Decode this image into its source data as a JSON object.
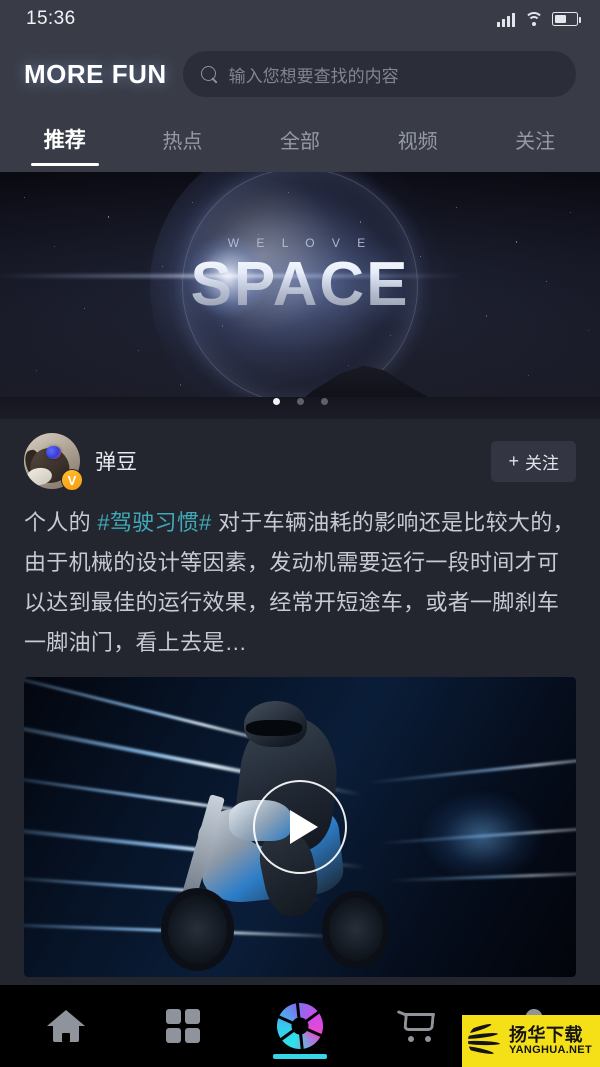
{
  "status_bar": {
    "time": "15:36",
    "icons": [
      "signal-icon",
      "wifi-icon",
      "battery-icon"
    ]
  },
  "header": {
    "brand": "MORE FUN",
    "search": {
      "placeholder": "输入您想要查找的内容",
      "value": "",
      "icon": "search-icon"
    }
  },
  "tabs": {
    "items": [
      {
        "label": "推荐",
        "active": true
      },
      {
        "label": "热点",
        "active": false
      },
      {
        "label": "全部",
        "active": false
      },
      {
        "label": "视频",
        "active": false
      },
      {
        "label": "关注",
        "active": false
      }
    ]
  },
  "banner": {
    "kicker": "W E   L O V E",
    "title": "SPACE",
    "dots": {
      "count": 3,
      "active_index": 0
    }
  },
  "post": {
    "author": {
      "name": "弹豆",
      "avatar": "dog-avatar",
      "verified_badge": "V"
    },
    "follow_button": {
      "plus": "+",
      "label": "关注"
    },
    "text_before_hashtag": "个人的 ",
    "hashtag": "#驾驶习惯#",
    "text_after_hashtag": " 对于车辆油耗的影响还是比较大的，由于机械的设计等因素，发动机需要运行一段时间才可以达到最佳的运行效果，经常开短途车，或者一脚刹车一脚油门，看上去是…",
    "media": {
      "type": "video",
      "alt": "motorcycle-rider-thumbnail",
      "play_icon": "play-icon"
    }
  },
  "bottom_nav": {
    "items": [
      {
        "name": "home",
        "icon": "home-icon",
        "active": false
      },
      {
        "name": "category",
        "icon": "grid-icon",
        "active": false
      },
      {
        "name": "camera",
        "icon": "shutter-icon",
        "active": true
      },
      {
        "name": "cart",
        "icon": "cart-icon",
        "active": false
      },
      {
        "name": "profile",
        "icon": "user-icon",
        "active": false
      }
    ]
  },
  "watermark": {
    "cn": "扬华下载",
    "en": "YANGHUA.NET"
  },
  "colors": {
    "page_bg": "#24262f",
    "chrome_bg": "#393c47",
    "search_bg": "#2b2e38",
    "nav_bg": "#000000",
    "hashtag": "#3fa9b8",
    "accent_cyan": "#35d6e8",
    "accent_magenta": "#e84ad1",
    "verified": "#f79b12",
    "watermark_bg": "#f5e017",
    "text_primary": "#e8e9ee",
    "text_muted": "#9499a5"
  }
}
